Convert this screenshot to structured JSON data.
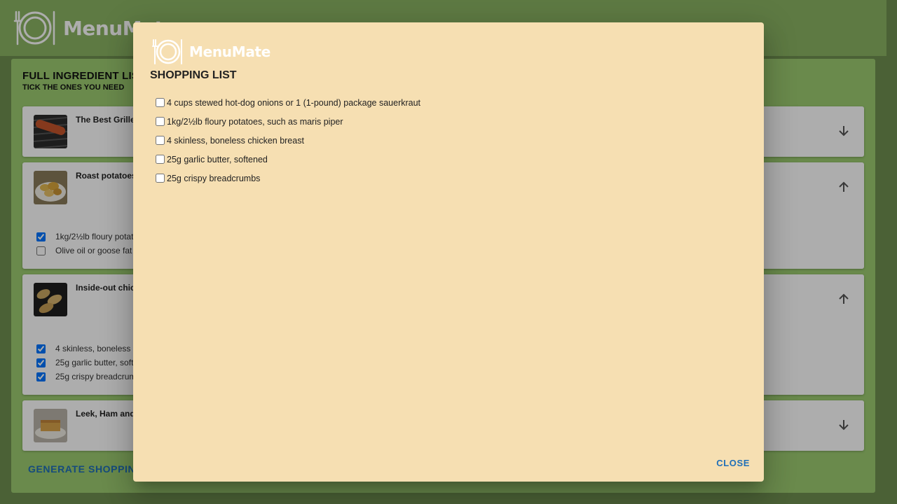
{
  "app": {
    "name": "MenuMate",
    "logo_icon": "plate-fork-icon",
    "colors": {
      "header": "#8bb464",
      "panel": "#9ccc70",
      "dialog": "#f6dfb2",
      "accent": "#1f6fb8"
    }
  },
  "main": {
    "heading": "FULL INGREDIENT LIST",
    "subheading": "TICK THE ONES YOU NEED",
    "recipes": [
      {
        "title": "The Best Grilled Hot Dogs",
        "toggle_icon": "arrow-down-icon",
        "expanded": false,
        "items": []
      },
      {
        "title": "Roast potatoes",
        "toggle_icon": "arrow-up-icon",
        "expanded": true,
        "items": [
          {
            "label": "1kg/2½lb floury potatoes, such as maris piper",
            "checked": true
          },
          {
            "label": "Olive oil or goose fat",
            "checked": false
          }
        ]
      },
      {
        "title": "Inside-out chicken Kiev",
        "toggle_icon": "arrow-up-icon",
        "expanded": true,
        "items": [
          {
            "label": "4 skinless, boneless chicken breast",
            "checked": true
          },
          {
            "label": "25g garlic butter, softened",
            "checked": true
          },
          {
            "label": "25g crispy breadcrumbs",
            "checked": true
          }
        ]
      },
      {
        "title": "Leek, Ham and Cheese Pie",
        "toggle_icon": "arrow-down-icon",
        "expanded": false,
        "items": []
      }
    ],
    "generate_label": "GENERATE SHOPPING LIST"
  },
  "dialog": {
    "logo_text": "MenuMate",
    "title": "SHOPPING LIST",
    "items": [
      {
        "label": "4 cups stewed hot-dog onions or 1 (1-pound) package sauerkraut",
        "checked": false
      },
      {
        "label": "1kg/2½lb floury potatoes, such as maris piper",
        "checked": false
      },
      {
        "label": "4 skinless, boneless chicken breast",
        "checked": false
      },
      {
        "label": "25g garlic butter, softened",
        "checked": false
      },
      {
        "label": "25g crispy breadcrumbs",
        "checked": false
      }
    ],
    "close_label": "CLOSE"
  }
}
